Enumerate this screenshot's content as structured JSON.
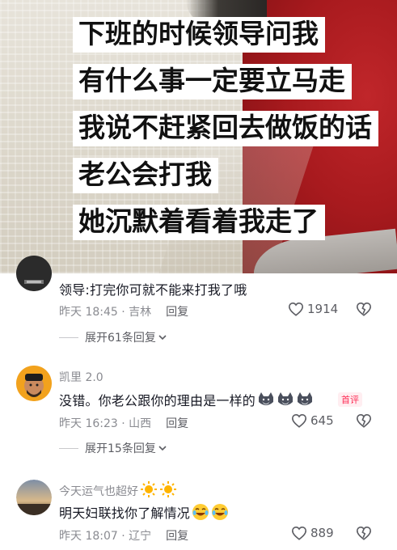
{
  "video": {
    "caption_lines": [
      "下班的时候领导问我",
      "有什么事一定要立马走",
      "我说不赶紧回去做饭的话",
      "老公会打我",
      "她沉默着看着我走了"
    ]
  },
  "comments": [
    {
      "text": "领导:打完你可就不能来打我了哦",
      "time": "昨天 18:45",
      "location": "吉林",
      "reply_label": "回复",
      "likes": "1914",
      "expand_label": "展开61条回复"
    },
    {
      "username": "凯里 2.0",
      "text": "没错。你老公跟你的理由是一样的",
      "emoji_count": 3,
      "badge": "首评",
      "time": "昨天 16:23",
      "location": "山西",
      "reply_label": "回复",
      "likes": "645",
      "expand_label": "展开15条回复"
    },
    {
      "username": "今天运气也超好",
      "text": "明天妇联找你了解情况",
      "time": "昨天 18:07",
      "location": "辽宁",
      "reply_label": "回复",
      "likes": "889"
    }
  ],
  "colors": {
    "accent_red": "#fe2c55",
    "secondary_text": "#8a8b91",
    "video_floor_red": "#b0191d"
  },
  "icons": [
    "heart-outline-icon",
    "dislike-heart-icon",
    "chevron-down-icon",
    "wolf-emoji-icon",
    "sun-emoji-icon",
    "laugh-cry-emoji-icon"
  ]
}
